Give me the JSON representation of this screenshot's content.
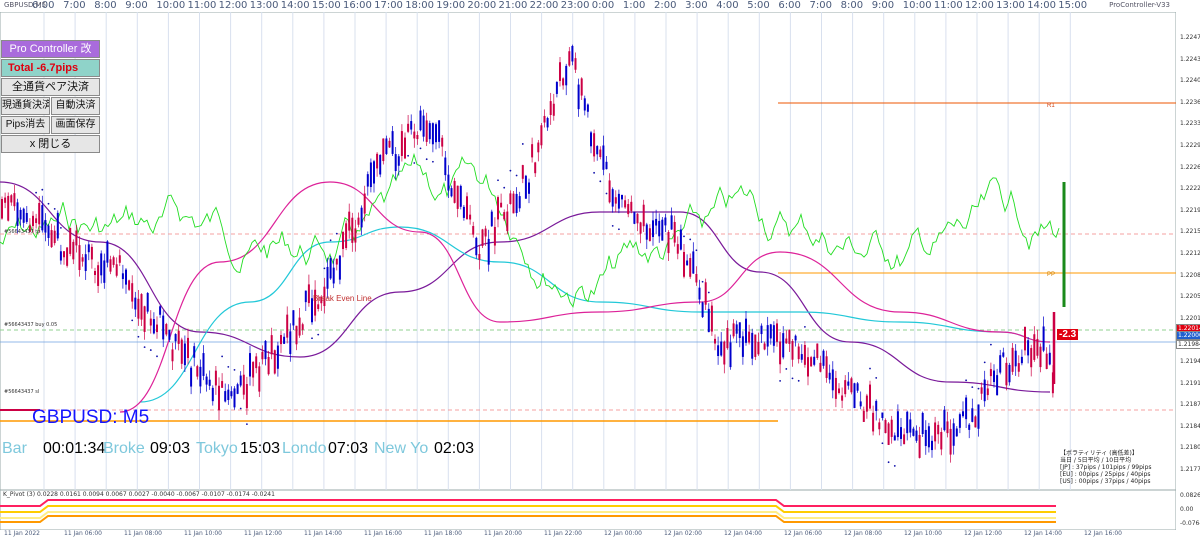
{
  "window": {
    "symbol_small": "GBPUSD,M5",
    "indicator_version": "ProController-V33"
  },
  "top_axis": {
    "labels": [
      "6:00",
      "7:00",
      "8:00",
      "9:00",
      "10:00",
      "11:00",
      "12:00",
      "13:00",
      "14:00",
      "15:00",
      "16:00",
      "17:00",
      "18:00",
      "19:00",
      "20:00",
      "21:00",
      "22:00",
      "23:00",
      "0:00",
      "1:00",
      "2:00",
      "3:00",
      "4:00",
      "5:00",
      "6:00",
      "7:00",
      "8:00",
      "9:00",
      "10:00",
      "11:00",
      "12:00",
      "13:00",
      "14:00",
      "15:00"
    ]
  },
  "panel": {
    "title": "Pro Controller 改",
    "total": "Total   -6.7pips",
    "close_all_pairs": "全通貨ペア決済",
    "close_current": "現通貨決済",
    "auto_close": "自動決済",
    "clear_pips": "Pips消去",
    "save_screen": "画面保存",
    "close": "x 閉じる"
  },
  "symbol_label": "GBPUSD: M5",
  "info": {
    "bar_key": "Bar",
    "bar_val": "00:01:34",
    "broker_key": "Broke",
    "broker_val": "09:03",
    "tokyo_key": "Tokyo",
    "tokyo_val": "15:03",
    "london_key": "Londo",
    "london_val": "07:03",
    "ny_key": "New Yo",
    "ny_val": "02:03"
  },
  "annotations": {
    "break_even": "Break Even Line",
    "r1": "R1",
    "pp": "PP",
    "current_profit": "-2.3",
    "line_buy": "#56643437 buy 0.05",
    "line_tp": "#56643437 tp",
    "line_sl": "#56643437 sl"
  },
  "right_axis": {
    "prices": [
      "1.22470",
      "1.22435",
      "1.22400",
      "1.22365",
      "1.22330",
      "1.22295",
      "1.22260",
      "1.22225",
      "1.22190",
      "1.22155",
      "1.22120",
      "1.22085",
      "1.22050",
      "1.22015",
      "1.21980",
      "1.21945",
      "1.21910",
      "1.21875",
      "1.21840",
      "1.21805",
      "1.21770"
    ],
    "current_price": "1.22014",
    "bid_price": "1.22000",
    "ask_price": "1.21984"
  },
  "volatility_box": {
    "header": "【ボラティリティ (高低差)】",
    "cols": "当日 / 5日平均 / 10日平均",
    "jp": "[JP] :  37pips / 101pips /  99pips",
    "eu": "[EU] :  00pips /  25pips /  40pips",
    "us": "[US] :  00pips /  37pips /  40pips"
  },
  "sub_window": {
    "title": "K_Pivot (3) 0.0228 0.0161 0.0094 0.0067 0.0027 -0.0040 -0.0067 -0.0107 -0.0174 -0.0241",
    "axis": [
      "0.0826",
      "0.00",
      "-0.0764"
    ]
  },
  "bottom_axis": {
    "dates": [
      "11 Jan 2022",
      "11 Jan 06:00",
      "11 Jan 08:00",
      "11 Jan 10:00",
      "11 Jan 12:00",
      "11 Jan 14:00",
      "11 Jan 16:00",
      "11 Jan 18:00",
      "11 Jan 20:00",
      "11 Jan 22:00",
      "12 Jan 00:00",
      "12 Jan 02:00",
      "12 Jan 04:00",
      "12 Jan 06:00",
      "12 Jan 08:00",
      "12 Jan 10:00",
      "12 Jan 12:00",
      "12 Jan 14:00",
      "12 Jan 16:00"
    ]
  },
  "colors": {
    "bull_candle": "#0000cc",
    "bear_candle": "#cc0044",
    "rsi_green": "#22dd22",
    "ma_cyan": "#22c8d8",
    "ma_magenta": "#dd2299",
    "ma_purple": "#7a1a9a",
    "parabolic_blue": "#1010aa",
    "pivot_orange": "#ff9900",
    "r1_red": "#ee5500",
    "tp_green": "#1a8a1a"
  }
}
